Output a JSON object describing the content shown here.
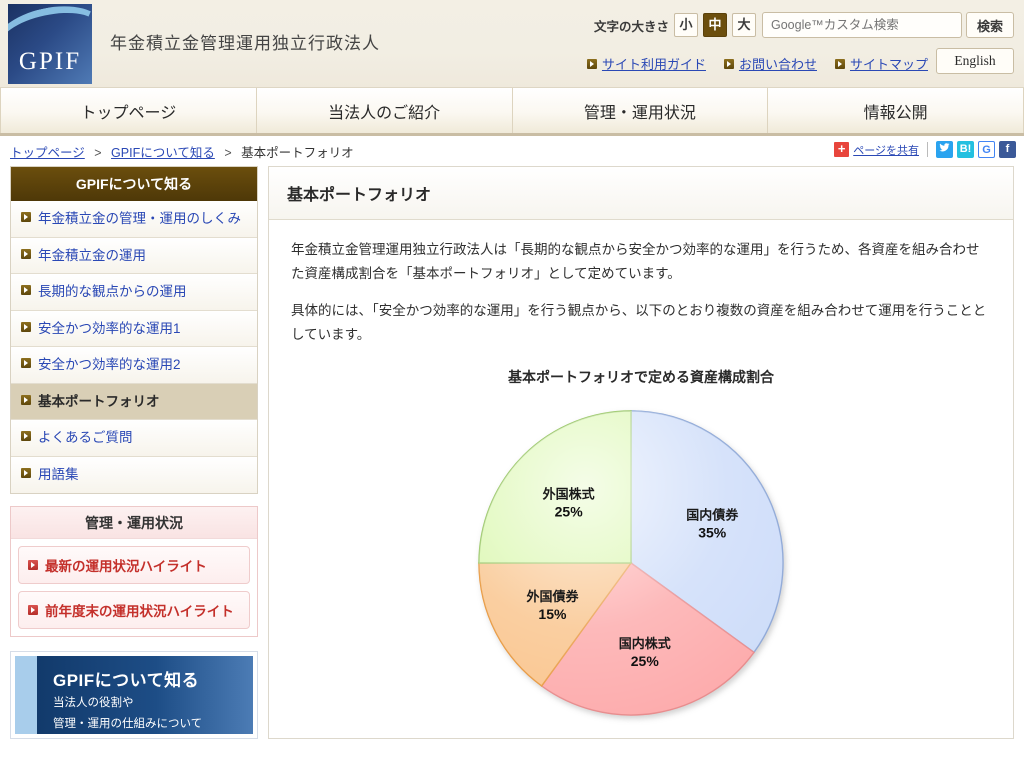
{
  "header": {
    "logo_text": "GPIF",
    "org_name": "年金積立金管理運用独立行政法人",
    "fontsize_label": "文字の大きさ",
    "fontsize_options": [
      "小",
      "中",
      "大"
    ],
    "fontsize_selected": "中",
    "search_placeholder": "Google™カスタム検索",
    "search_button": "検索",
    "links": [
      "サイト利用ガイド",
      "お問い合わせ",
      "サイトマップ"
    ],
    "english_button": "English"
  },
  "gnav": [
    {
      "label": "トップページ"
    },
    {
      "label": "当法人のご紹介"
    },
    {
      "label": "管理・運用状況"
    },
    {
      "label": "情報公開"
    }
  ],
  "breadcrumb": {
    "items": [
      "トップページ",
      "GPIFについて知る",
      "基本ポートフォリオ"
    ],
    "separator": ">"
  },
  "share": {
    "plus": "+",
    "label": "ページを共有",
    "buttons": [
      {
        "name": "twitter",
        "glyph": "🐦",
        "color": "#2aa3ef"
      },
      {
        "name": "hatena",
        "glyph": "B!",
        "color": "#24c0e0"
      },
      {
        "name": "google",
        "glyph": "G",
        "color": "#4285f4"
      },
      {
        "name": "facebook",
        "glyph": "f",
        "color": "#3b5998"
      }
    ]
  },
  "sidebar": {
    "menu_title": "GPIFについて知る",
    "items": [
      {
        "label": "年金積立金の管理・運用のしくみ",
        "current": false
      },
      {
        "label": "年金積立金の運用",
        "current": false
      },
      {
        "label": "長期的な観点からの運用",
        "current": false
      },
      {
        "label": "安全かつ効率的な運用1",
        "current": false
      },
      {
        "label": "安全かつ効率的な運用2",
        "current": false
      },
      {
        "label": "基本ポートフォリオ",
        "current": true
      },
      {
        "label": "よくあるご質問",
        "current": false
      },
      {
        "label": "用語集",
        "current": false
      }
    ],
    "status_box": {
      "title": "管理・運用状況",
      "buttons": [
        "最新の運用状況ハイライト",
        "前年度末の運用状況ハイライト"
      ]
    },
    "banner": {
      "title": "GPIFについて知る",
      "line1": "当法人の役割や",
      "line2": "管理・運用の仕組みについて"
    }
  },
  "main": {
    "page_title": "基本ポートフォリオ",
    "paragraph1": "年金積立金管理運用独立行政法人は「長期的な観点から安全かつ効率的な運用」を行うため、各資産を組み合わせた資産構成割合を「基本ポートフォリオ」として定めています。",
    "paragraph2": "具体的には、「安全かつ効率的な運用」を行う観点から、以下のとおり複数の資産を組み合わせて運用を行うこととしています。"
  },
  "chart_data": {
    "type": "pie",
    "title": "基本ポートフォリオで定める資産構成割合",
    "xlabel": "",
    "ylabel": "",
    "legend_position": "none",
    "start_angle_deg": 0,
    "direction": "clockwise",
    "categories": [
      "国内債券",
      "国内株式",
      "外国債券",
      "外国株式"
    ],
    "values": [
      35,
      25,
      15,
      25
    ],
    "value_suffix": "%",
    "colors": [
      "#cddcf9",
      "#fdaaab",
      "#f9c48c",
      "#d9f7ac"
    ],
    "stroke_colors": [
      "#8fa9d8",
      "#e88b8c",
      "#e8993f",
      "#9cc96a"
    ],
    "slices": [
      {
        "label": "国内債券",
        "value": 35,
        "display": "35%",
        "color": "#cddcf9"
      },
      {
        "label": "国内株式",
        "value": 25,
        "display": "25%",
        "color": "#fdaaab"
      },
      {
        "label": "外国債券",
        "value": 15,
        "display": "15%",
        "color": "#f9c48c"
      },
      {
        "label": "外国株式",
        "value": 25,
        "display": "25%",
        "color": "#d9f7ac"
      }
    ]
  }
}
